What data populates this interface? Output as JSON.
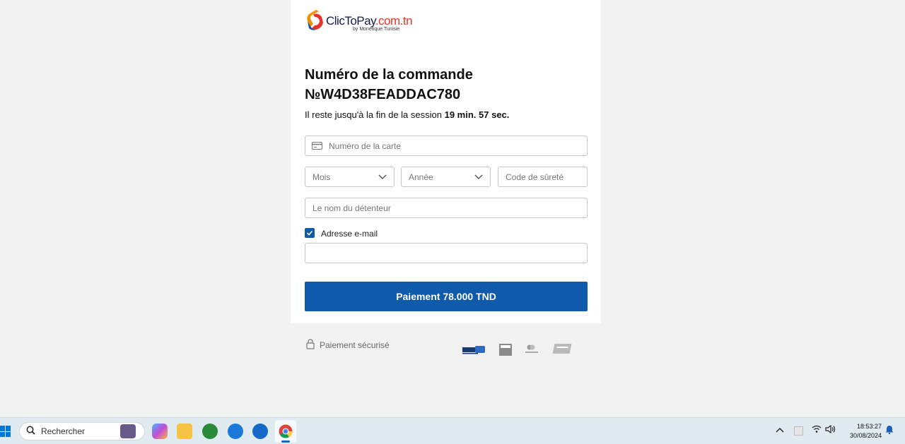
{
  "brand": {
    "name_main": "ClicToPay",
    "name_domain": ".com.tn",
    "subtitle": "by Monétique Tunisie"
  },
  "order": {
    "title": "Numéro de la commande №W4D38FEADDAC780"
  },
  "session": {
    "prefix": "Il reste jusqu'à la fin de la session",
    "remaining": "19 min. 57 sec."
  },
  "form": {
    "card_number_placeholder": "Numéro de la carte",
    "month_placeholder": "Mois",
    "year_placeholder": "Année",
    "cvv_placeholder": "Code de sûreté",
    "holder_placeholder": "Le nom du détenteur",
    "email_checkbox_label": "Adresse e-mail",
    "email_checked": true,
    "email_value": "",
    "pay_button": "Paiement 78.000 TND"
  },
  "footer": {
    "secure_label": "Paiement sécurisé",
    "payment_logos": [
      "monetique-logo",
      "visa-logo",
      "mastercard-id-check-logo",
      "unionpay-logo"
    ]
  },
  "taskbar": {
    "search_placeholder": "Rechercher",
    "time": "18:53:27",
    "date": "30/08/2024"
  },
  "colors": {
    "primary": "#0f5aaa",
    "brand_red": "#e8322b",
    "brand_navy": "#1a1a4e"
  }
}
